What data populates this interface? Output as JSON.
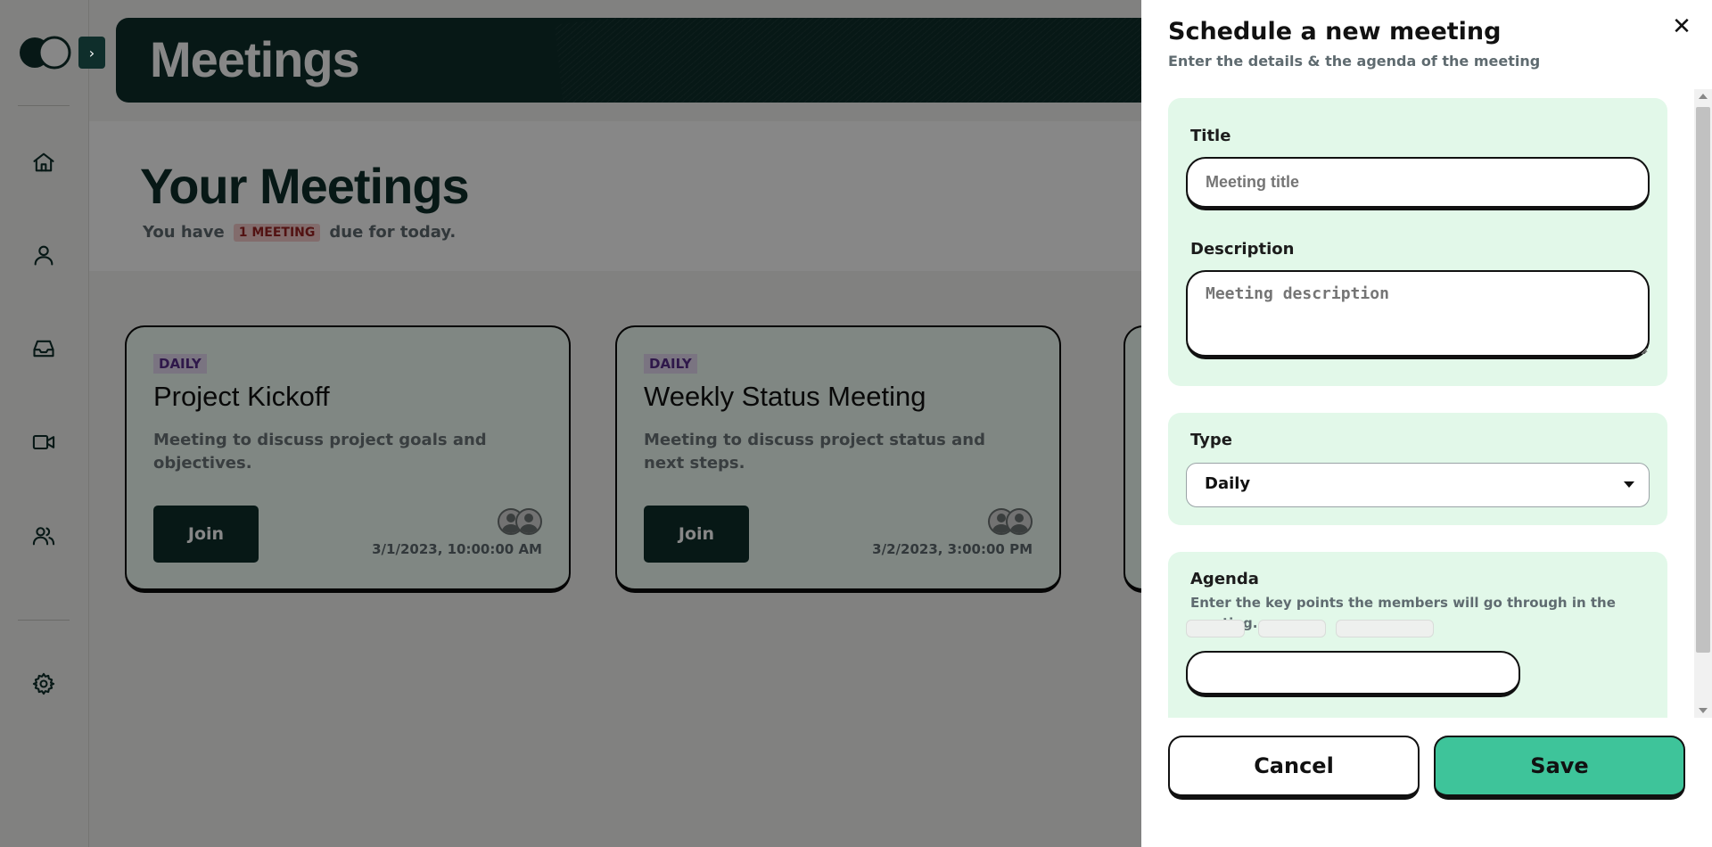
{
  "sidebar": {
    "nav_items": [
      {
        "id": "home",
        "icon": "home-icon"
      },
      {
        "id": "profile",
        "icon": "user-icon"
      },
      {
        "id": "inbox",
        "icon": "inbox-icon"
      },
      {
        "id": "meetings",
        "icon": "video-icon"
      },
      {
        "id": "team",
        "icon": "users-icon"
      },
      {
        "id": "settings",
        "icon": "gear-icon"
      }
    ]
  },
  "banner": {
    "title": "Meetings"
  },
  "hero": {
    "title": "Your Meetings",
    "sub_before": "You have",
    "badge": "1 MEETING",
    "sub_after": "due for today."
  },
  "cards": [
    {
      "tag": "DAILY",
      "title": "Project Kickoff",
      "description": "Meeting to discuss project goals and objectives.",
      "join_label": "Join",
      "date": "3/1/2023, 10:00:00 AM"
    },
    {
      "tag": "DAILY",
      "title": "Weekly Status Meeting",
      "description": "Meeting to discuss project status and next steps.",
      "join_label": "Join",
      "date": "3/2/2023, 3:00:00 PM"
    }
  ],
  "drawer": {
    "title": "Schedule a new meeting",
    "subtitle": "Enter the details & the agenda of the meeting",
    "title_field": {
      "label": "Title",
      "placeholder": "Meeting title",
      "value": ""
    },
    "description_field": {
      "label": "Description",
      "placeholder": "Meeting description",
      "value": ""
    },
    "type_field": {
      "label": "Type",
      "selected": "Daily"
    },
    "agenda": {
      "label": "Agenda",
      "help": "Enter the key points the members will go through in the meeting.",
      "input_value": ""
    },
    "cancel_label": "Cancel",
    "save_label": "Save"
  },
  "colors": {
    "brand_dark": "#0f2e2b",
    "accent_green": "#3ec49a",
    "section_bg": "#e2f8e9",
    "card_bg": "#f2fff7"
  }
}
